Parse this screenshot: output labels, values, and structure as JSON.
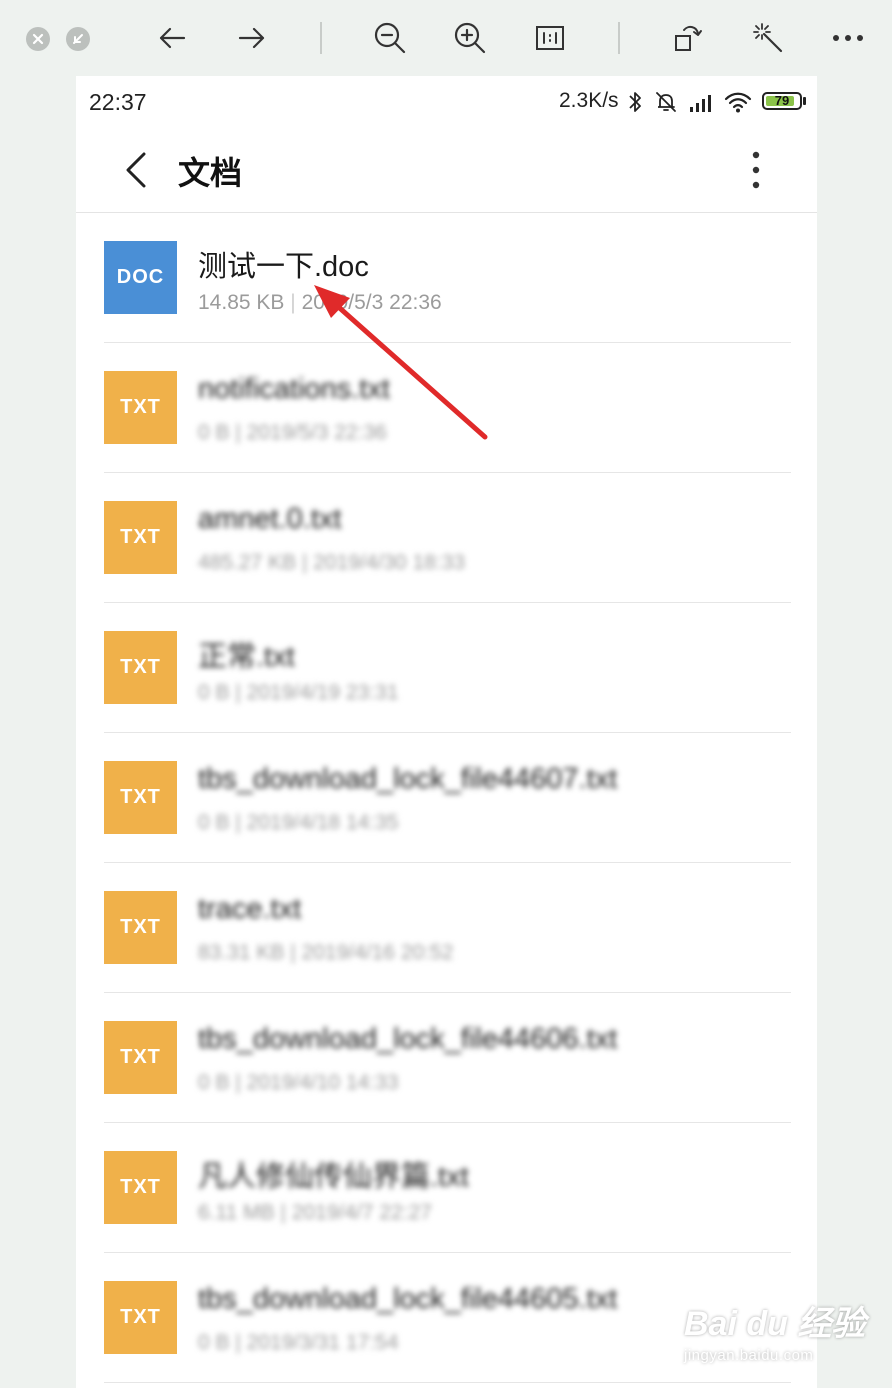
{
  "status_bar": {
    "time": "22:37",
    "network_speed": "2.3K/s",
    "battery_level": "79"
  },
  "header": {
    "title": "文档"
  },
  "files": [
    {
      "type": "DOC",
      "name": "测试一下.doc",
      "size": "14.85 KB",
      "date": "2019/5/3 22:36",
      "color": "#4a8fd6"
    },
    {
      "type": "TXT",
      "name": "notifications.txt",
      "size": "0 B",
      "date": "2019/5/3 22:36",
      "color": "#f0b14a"
    },
    {
      "type": "TXT",
      "name": "amnet.0.txt",
      "size": "485.27 KB",
      "date": "2019/4/30 18:33",
      "color": "#f0b14a"
    },
    {
      "type": "TXT",
      "name": "正常.txt",
      "size": "0 B",
      "date": "2019/4/19 23:31",
      "color": "#f0b14a"
    },
    {
      "type": "TXT",
      "name": "tbs_download_lock_file44607.txt",
      "size": "0 B",
      "date": "2019/4/18 14:35",
      "color": "#f0b14a"
    },
    {
      "type": "TXT",
      "name": "trace.txt",
      "size": "83.31 KB",
      "date": "2019/4/16 20:52",
      "color": "#f0b14a"
    },
    {
      "type": "TXT",
      "name": "tbs_download_lock_file44606.txt",
      "size": "0 B",
      "date": "2019/4/10 14:33",
      "color": "#f0b14a"
    },
    {
      "type": "TXT",
      "name": "凡人修仙传仙界篇.txt",
      "size": "6.11 MB",
      "date": "2019/4/7 22:27",
      "color": "#f0b14a"
    },
    {
      "type": "TXT",
      "name": "tbs_download_lock_file44605.txt",
      "size": "0 B",
      "date": "2019/3/31 17:54",
      "color": "#f0b14a"
    }
  ],
  "meta_separator": "|",
  "watermark": {
    "main": "Bai du 经验",
    "sub": "jingyan.baidu.com"
  },
  "colors": {
    "annotation_arrow": "#e02a2a",
    "doc_icon": "#4a8fd6",
    "txt_icon": "#f0b14a"
  }
}
